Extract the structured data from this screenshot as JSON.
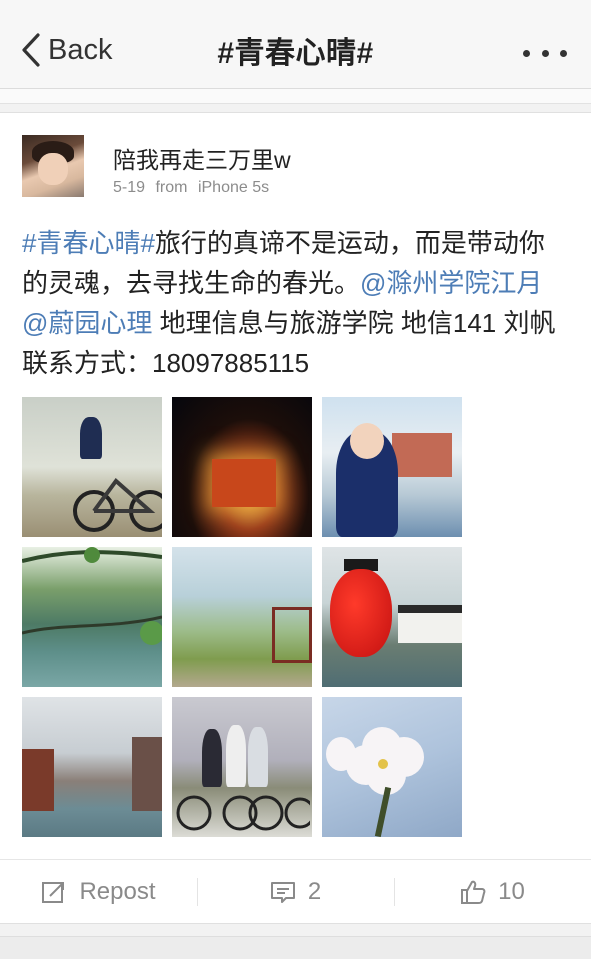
{
  "nav": {
    "back_label": "Back",
    "title": "#青春心晴#",
    "more_icon": "ellipsis-icon"
  },
  "post": {
    "username": "陪我再走三万里w",
    "date": "5-19",
    "source_prefix": "from",
    "source": "iPhone 5s",
    "text_segments": [
      {
        "type": "topic",
        "text": "#青春心晴#"
      },
      {
        "type": "plain",
        "text": "旅行的真谛不是运动，而是带动你的灵魂，去寻找生命的春光。"
      },
      {
        "type": "mention",
        "text": "@滁州学院江月"
      },
      {
        "type": "plain",
        "text": " "
      },
      {
        "type": "mention",
        "text": "@蔚园心理"
      },
      {
        "type": "plain",
        "text": " 地理信息与旅游学院 地信141 刘帆 联系方式：18097885115"
      }
    ],
    "photo_count": 9
  },
  "actions": {
    "repost_label": "Repost",
    "comment_count": "2",
    "like_count": "10"
  },
  "colors": {
    "link": "#4d7db6",
    "meta": "#8c8c8c",
    "action": "#8a8a8a"
  }
}
